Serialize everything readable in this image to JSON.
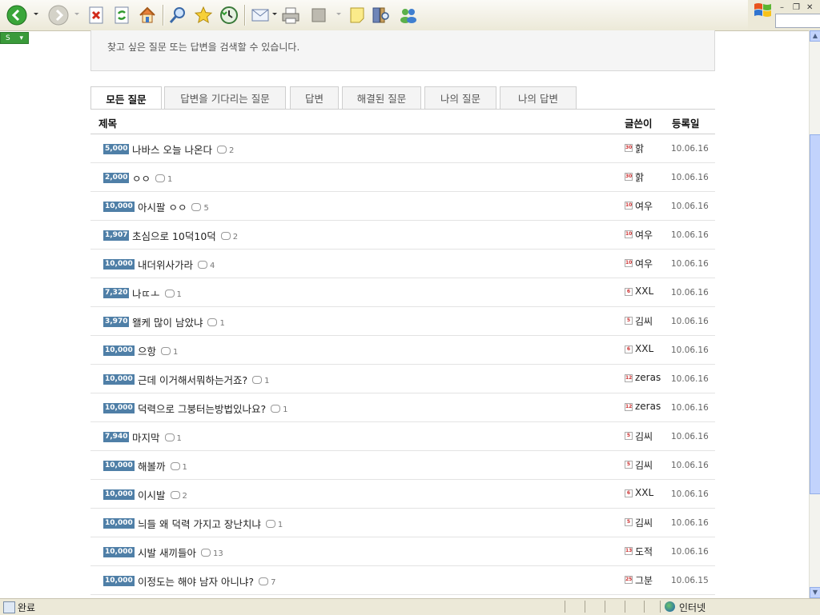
{
  "browser": {
    "buttons": [
      "back",
      "forward",
      "stop",
      "refresh",
      "home",
      "search",
      "favorites",
      "history",
      "mail",
      "print",
      "edit",
      "discuss",
      "research",
      "messenger"
    ],
    "status_text": "완료",
    "zone_text": "인터넷"
  },
  "page": {
    "search_hint": "찾고 싶은 질문 또는 답변을 검색할 수 있습니다.",
    "tabs": [
      {
        "label": "모든 질문"
      },
      {
        "label": "답변을 기다리는 질문"
      },
      {
        "label": "답변"
      },
      {
        "label": "해결된 질문"
      },
      {
        "label": "나의 질문"
      },
      {
        "label": "나의 답변"
      }
    ],
    "columns": {
      "title": "제목",
      "author": "글쓴이",
      "date": "등록일"
    },
    "rows": [
      {
        "points": "5,000",
        "title": "나바스 오늘 나온다",
        "comments": "2",
        "level": "30",
        "author": "핡",
        "date": "10.06.16"
      },
      {
        "points": "2,000",
        "title": "ㅇㅇ",
        "comments": "1",
        "level": "30",
        "author": "핡",
        "date": "10.06.16"
      },
      {
        "points": "10,000",
        "title": "아시팔 ㅇㅇ",
        "comments": "5",
        "level": "10",
        "author": "여우",
        "date": "10.06.16"
      },
      {
        "points": "1,907",
        "title": "초심으로 10덕10덕",
        "comments": "2",
        "level": "10",
        "author": "여우",
        "date": "10.06.16"
      },
      {
        "points": "10,000",
        "title": "내더위사가라",
        "comments": "4",
        "level": "10",
        "author": "여우",
        "date": "10.06.16"
      },
      {
        "points": "7,320",
        "title": "나ㄸㅗ",
        "comments": "1",
        "level": "6",
        "author": "XXL",
        "date": "10.06.16"
      },
      {
        "points": "3,970",
        "title": "왤케 많이 남았냐",
        "comments": "1",
        "level": "5",
        "author": "김씨",
        "date": "10.06.16"
      },
      {
        "points": "10,000",
        "title": "으항",
        "comments": "1",
        "level": "6",
        "author": "XXL",
        "date": "10.06.16"
      },
      {
        "points": "10,000",
        "title": "근데 이거해서뭐하는거죠?",
        "comments": "1",
        "level": "12",
        "author": "zeras",
        "date": "10.06.16"
      },
      {
        "points": "10,000",
        "title": "덕력으로 그붕터는방법있나요?",
        "comments": "1",
        "level": "12",
        "author": "zeras",
        "date": "10.06.16"
      },
      {
        "points": "7,940",
        "title": "마지막",
        "comments": "1",
        "level": "5",
        "author": "김씨",
        "date": "10.06.16"
      },
      {
        "points": "10,000",
        "title": "해볼까",
        "comments": "1",
        "level": "5",
        "author": "김씨",
        "date": "10.06.16"
      },
      {
        "points": "10,000",
        "title": "이시발",
        "comments": "2",
        "level": "6",
        "author": "XXL",
        "date": "10.06.16"
      },
      {
        "points": "10,000",
        "title": "늬들 왜 덕력 가지고 장난치냐",
        "comments": "1",
        "level": "5",
        "author": "김씨",
        "date": "10.06.16"
      },
      {
        "points": "10,000",
        "title": "시발 새끼들아",
        "comments": "13",
        "level": "13",
        "author": "도적",
        "date": "10.06.16"
      },
      {
        "points": "10,000",
        "title": "이정도는 해야 남자 아니냐?",
        "comments": "7",
        "level": "25",
        "author": "그분",
        "date": "10.06.15"
      }
    ]
  }
}
